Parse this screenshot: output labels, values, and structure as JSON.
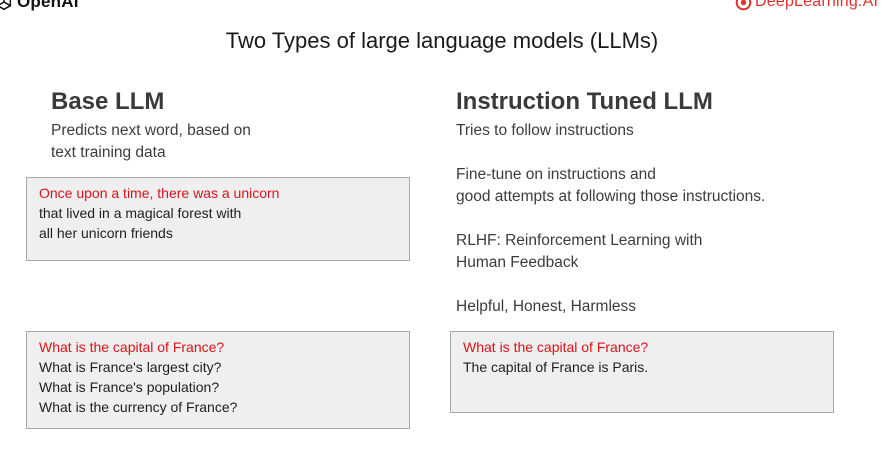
{
  "logos": {
    "openai": "OpenAI",
    "deeplearning": "DeepLearning.AI",
    "accent_color": "#e0312e"
  },
  "title": "Two Types of large language models (LLMs)",
  "base_llm": {
    "heading": "Base LLM",
    "description": [
      "Predicts next word, based on",
      "text training data"
    ],
    "example_unicorn": {
      "prompt": "Once upon a time, there was a unicorn",
      "completion": [
        "that lived in a magical forest with",
        "all her unicorn friends"
      ]
    },
    "example_france": {
      "prompt": "What is the capital of France?",
      "completion": [
        "What is France's largest city?",
        "What is France's population?",
        "What is the currency of France?"
      ]
    }
  },
  "instruction_tuned_llm": {
    "heading": "Instruction Tuned LLM",
    "points": [
      [
        "Tries to follow instructions"
      ],
      [
        "Fine-tune on instructions and",
        "good attempts at following those instructions."
      ],
      [
        "RLHF: Reinforcement Learning with",
        "Human Feedback"
      ],
      [
        "Helpful, Honest, Harmless"
      ]
    ],
    "example_france": {
      "prompt": "What is the capital of France?",
      "completion": [
        "The capital of France is Paris."
      ]
    }
  },
  "colors": {
    "prompt_text": "#d8141b",
    "box_background": "#efefef",
    "box_border": "#a9a9a9"
  }
}
